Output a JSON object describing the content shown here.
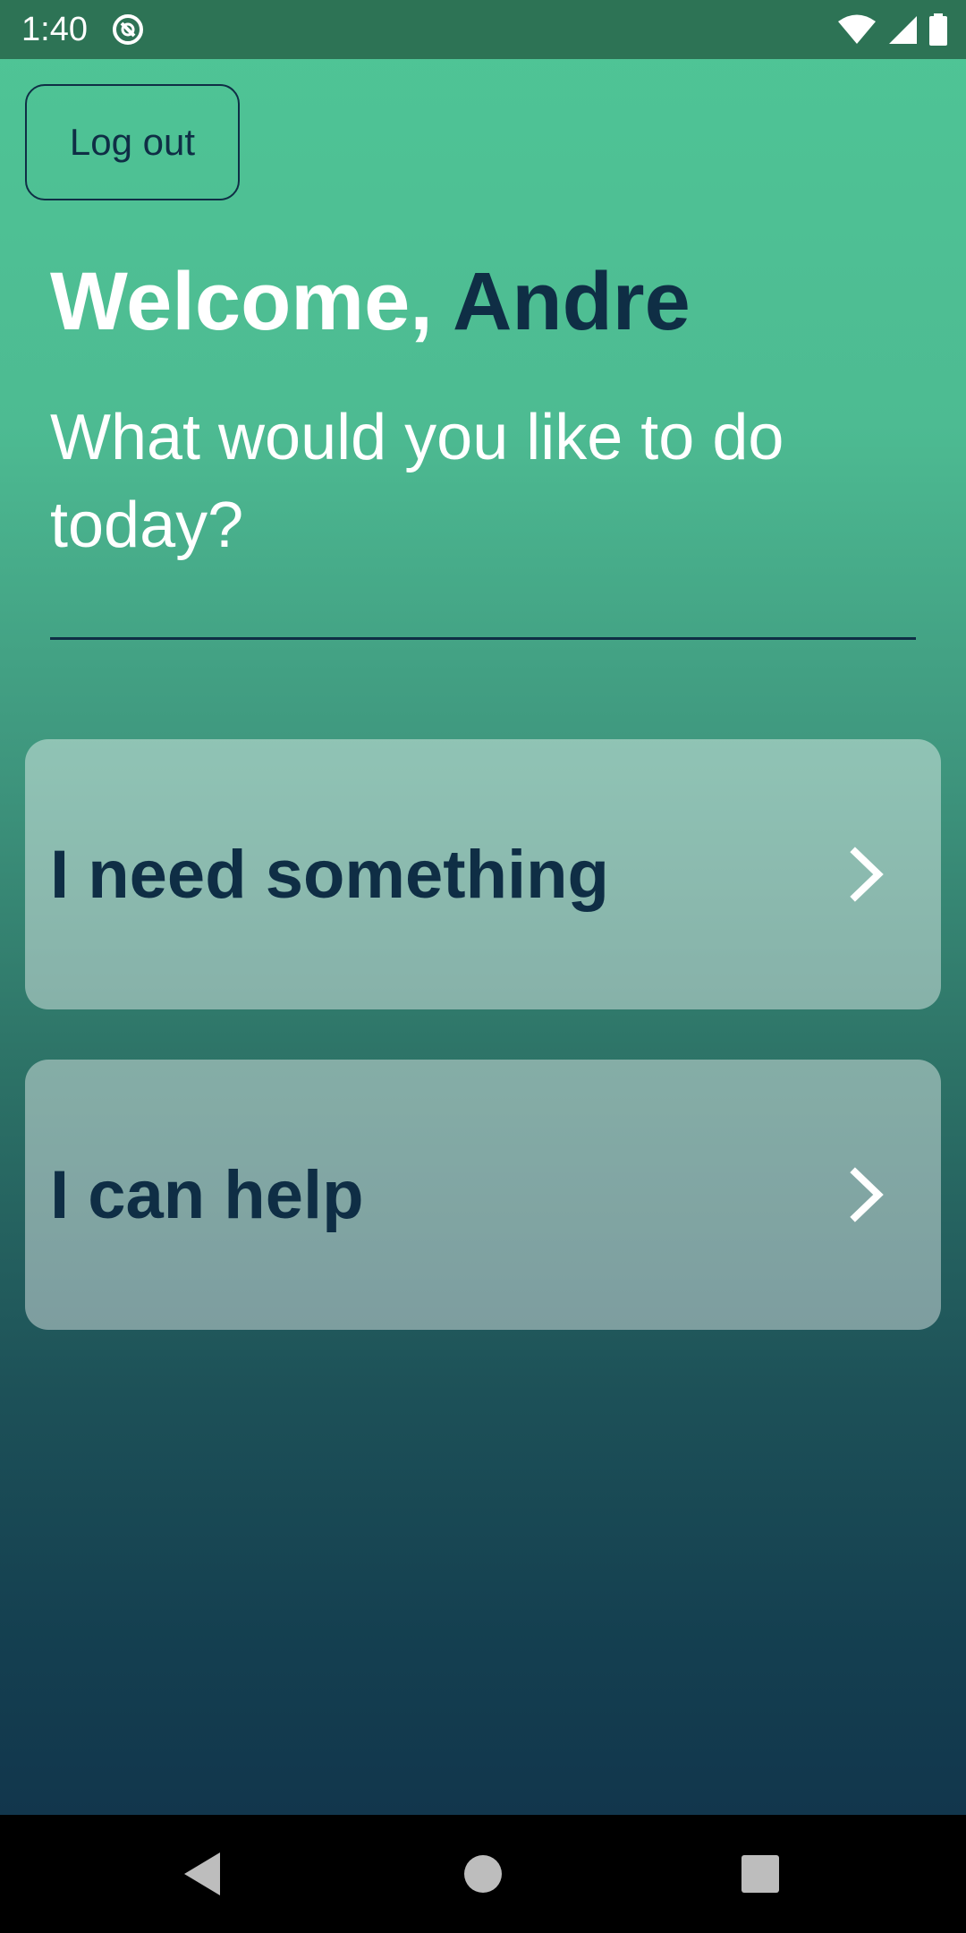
{
  "status_bar": {
    "time": "1:40",
    "icons": [
      "app-notification-icon",
      "wifi-icon",
      "signal-icon",
      "battery-icon"
    ]
  },
  "header": {
    "logout_label": "Log out"
  },
  "welcome": {
    "prefix": "Welcome, ",
    "name": "Andre",
    "subtitle": "What would you like to do today?"
  },
  "options": [
    {
      "label": "I need something",
      "icon": "chevron-right-icon"
    },
    {
      "label": "I can help",
      "icon": "chevron-right-icon"
    }
  ],
  "nav_bar": {
    "buttons": [
      "back-icon",
      "home-icon",
      "recents-icon"
    ]
  },
  "colors": {
    "gradient_top": "#4fc596",
    "gradient_bottom": "#10304a",
    "dark_text": "#0f2e45",
    "status_bar": "#2d7355",
    "card_overlay": "rgba(255,255,255,0.42)"
  }
}
